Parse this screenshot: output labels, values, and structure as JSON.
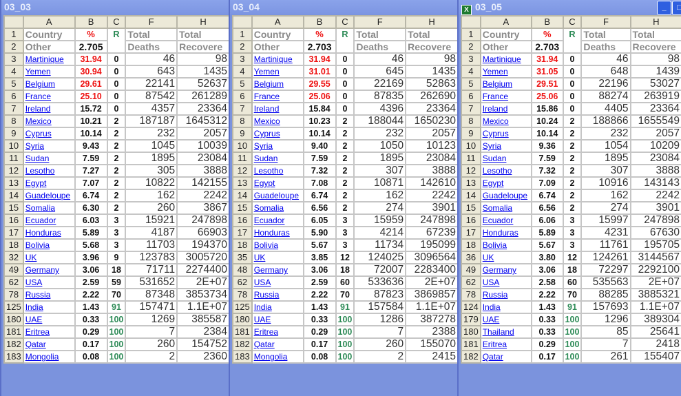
{
  "columns": [
    "A",
    "B",
    "C",
    "F",
    "H"
  ],
  "headers": {
    "country_1": "Country",
    "country_2": "Other",
    "pct_label": "%",
    "r_label": "R",
    "deaths_1": "Total",
    "deaths_2": "Deaths",
    "recovered_1": "Total",
    "recovered_2": "Recovere"
  },
  "colors": {
    "red": "#ee1111",
    "green": "#2e8b57",
    "link": "#0000ee"
  },
  "windows": [
    {
      "title": "03_03",
      "base": "2.705",
      "rows": [
        [
          "3",
          "Martinique",
          "31.94",
          "0",
          "46",
          "98"
        ],
        [
          "4",
          "Yemen",
          "30.94",
          "0",
          "643",
          "1435"
        ],
        [
          "5",
          "Belgium",
          "29.61",
          "0",
          "22141",
          "52637"
        ],
        [
          "6",
          "France",
          "25.10",
          "0",
          "87542",
          "261289"
        ],
        [
          "7",
          "Ireland",
          "15.72",
          "0",
          "4357",
          "23364"
        ],
        [
          "8",
          "Mexico",
          "10.21",
          "2",
          "187187",
          "1645312"
        ],
        [
          "9",
          "Cyprus",
          "10.14",
          "2",
          "232",
          "2057"
        ],
        [
          "10",
          "Syria",
          "9.43",
          "2",
          "1045",
          "10039"
        ],
        [
          "11",
          "Sudan",
          "7.59",
          "2",
          "1895",
          "23084"
        ],
        [
          "12",
          "Lesotho",
          "7.27",
          "2",
          "305",
          "3888"
        ],
        [
          "13",
          "Egypt",
          "7.07",
          "2",
          "10822",
          "142155"
        ],
        [
          "14",
          "Guadeloupe",
          "6.74",
          "2",
          "162",
          "2242"
        ],
        [
          "15",
          "Somalia",
          "6.30",
          "2",
          "260",
          "3867"
        ],
        [
          "16",
          "Ecuador",
          "6.03",
          "3",
          "15921",
          "247898"
        ],
        [
          "17",
          "Honduras",
          "5.89",
          "3",
          "4187",
          "66903"
        ],
        [
          "18",
          "Bolivia",
          "5.68",
          "3",
          "11703",
          "194370"
        ],
        [
          "32",
          "UK",
          "3.96",
          "9",
          "123783",
          "3005720"
        ],
        [
          "49",
          "Germany",
          "3.06",
          "18",
          "71711",
          "2274400"
        ],
        [
          "62",
          "USA",
          "2.59",
          "59",
          "531652",
          "2E+07"
        ],
        [
          "78",
          "Russia",
          "2.22",
          "70",
          "87348",
          "3853734"
        ],
        [
          "125",
          "India",
          "1.43",
          "91",
          "157471",
          "1.1E+07"
        ],
        [
          "180",
          "UAE",
          "0.33",
          "100",
          "1269",
          "385587"
        ],
        [
          "181",
          "Eritrea",
          "0.29",
          "100",
          "7",
          "2384"
        ],
        [
          "182",
          "Qatar",
          "0.17",
          "100",
          "260",
          "154752"
        ],
        [
          "183",
          "Mongolia",
          "0.08",
          "100",
          "2",
          "2360"
        ]
      ]
    },
    {
      "title": "03_04",
      "base": "2.703",
      "rows": [
        [
          "3",
          "Martinique",
          "31.94",
          "0",
          "46",
          "98"
        ],
        [
          "4",
          "Yemen",
          "31.01",
          "0",
          "645",
          "1435"
        ],
        [
          "5",
          "Belgium",
          "29.55",
          "0",
          "22169",
          "52863"
        ],
        [
          "6",
          "France",
          "25.06",
          "0",
          "87835",
          "262690"
        ],
        [
          "7",
          "Ireland",
          "15.84",
          "0",
          "4396",
          "23364"
        ],
        [
          "8",
          "Mexico",
          "10.23",
          "2",
          "188044",
          "1650230"
        ],
        [
          "9",
          "Cyprus",
          "10.14",
          "2",
          "232",
          "2057"
        ],
        [
          "10",
          "Syria",
          "9.40",
          "2",
          "1050",
          "10123"
        ],
        [
          "11",
          "Sudan",
          "7.59",
          "2",
          "1895",
          "23084"
        ],
        [
          "12",
          "Lesotho",
          "7.32",
          "2",
          "307",
          "3888"
        ],
        [
          "13",
          "Egypt",
          "7.08",
          "2",
          "10871",
          "142610"
        ],
        [
          "14",
          "Guadeloupe",
          "6.74",
          "2",
          "162",
          "2242"
        ],
        [
          "15",
          "Somalia",
          "6.56",
          "2",
          "274",
          "3901"
        ],
        [
          "16",
          "Ecuador",
          "6.05",
          "3",
          "15959",
          "247898"
        ],
        [
          "17",
          "Honduras",
          "5.90",
          "3",
          "4214",
          "67239"
        ],
        [
          "18",
          "Bolivia",
          "5.67",
          "3",
          "11734",
          "195099"
        ],
        [
          "35",
          "UK",
          "3.85",
          "12",
          "124025",
          "3096564"
        ],
        [
          "48",
          "Germany",
          "3.06",
          "18",
          "72007",
          "2283400"
        ],
        [
          "62",
          "USA",
          "2.59",
          "60",
          "533636",
          "2E+07"
        ],
        [
          "78",
          "Russia",
          "2.22",
          "70",
          "87823",
          "3869857"
        ],
        [
          "125",
          "India",
          "1.43",
          "91",
          "157584",
          "1.1E+07"
        ],
        [
          "180",
          "UAE",
          "0.33",
          "100",
          "1286",
          "387278"
        ],
        [
          "181",
          "Eritrea",
          "0.29",
          "100",
          "7",
          "2388"
        ],
        [
          "182",
          "Qatar",
          "0.17",
          "100",
          "260",
          "155070"
        ],
        [
          "183",
          "Mongolia",
          "0.08",
          "100",
          "2",
          "2415"
        ]
      ]
    },
    {
      "title": "03_05",
      "base": "2.703",
      "rows": [
        [
          "3",
          "Martinique",
          "31.94",
          "0",
          "46",
          "98"
        ],
        [
          "4",
          "Yemen",
          "31.05",
          "0",
          "648",
          "1439"
        ],
        [
          "5",
          "Belgium",
          "29.51",
          "0",
          "22196",
          "53027"
        ],
        [
          "6",
          "France",
          "25.06",
          "0",
          "88274",
          "263919"
        ],
        [
          "7",
          "Ireland",
          "15.86",
          "0",
          "4405",
          "23364"
        ],
        [
          "8",
          "Mexico",
          "10.24",
          "2",
          "188866",
          "1655549"
        ],
        [
          "9",
          "Cyprus",
          "10.14",
          "2",
          "232",
          "2057"
        ],
        [
          "10",
          "Syria",
          "9.36",
          "2",
          "1054",
          "10209"
        ],
        [
          "11",
          "Sudan",
          "7.59",
          "2",
          "1895",
          "23084"
        ],
        [
          "12",
          "Lesotho",
          "7.32",
          "2",
          "307",
          "3888"
        ],
        [
          "13",
          "Egypt",
          "7.09",
          "2",
          "10916",
          "143143"
        ],
        [
          "14",
          "Guadeloupe",
          "6.74",
          "2",
          "162",
          "2242"
        ],
        [
          "15",
          "Somalia",
          "6.56",
          "2",
          "274",
          "3901"
        ],
        [
          "16",
          "Ecuador",
          "6.06",
          "3",
          "15997",
          "247898"
        ],
        [
          "17",
          "Honduras",
          "5.89",
          "3",
          "4231",
          "67630"
        ],
        [
          "18",
          "Bolivia",
          "5.67",
          "3",
          "11761",
          "195705"
        ],
        [
          "36",
          "UK",
          "3.80",
          "12",
          "124261",
          "3144567"
        ],
        [
          "49",
          "Germany",
          "3.06",
          "18",
          "72297",
          "2292100"
        ],
        [
          "62",
          "USA",
          "2.58",
          "60",
          "535563",
          "2E+07"
        ],
        [
          "78",
          "Russia",
          "2.22",
          "70",
          "88285",
          "3885321"
        ],
        [
          "124",
          "India",
          "1.43",
          "91",
          "157693",
          "1.1E+07"
        ],
        [
          "179",
          "UAE",
          "0.33",
          "100",
          "1296",
          "389304"
        ],
        [
          "180",
          "Thailand",
          "0.33",
          "100",
          "85",
          "25641"
        ],
        [
          "181",
          "Eritrea",
          "0.29",
          "100",
          "7",
          "2418"
        ],
        [
          "182",
          "Qatar",
          "0.17",
          "100",
          "261",
          "155407"
        ]
      ]
    }
  ]
}
